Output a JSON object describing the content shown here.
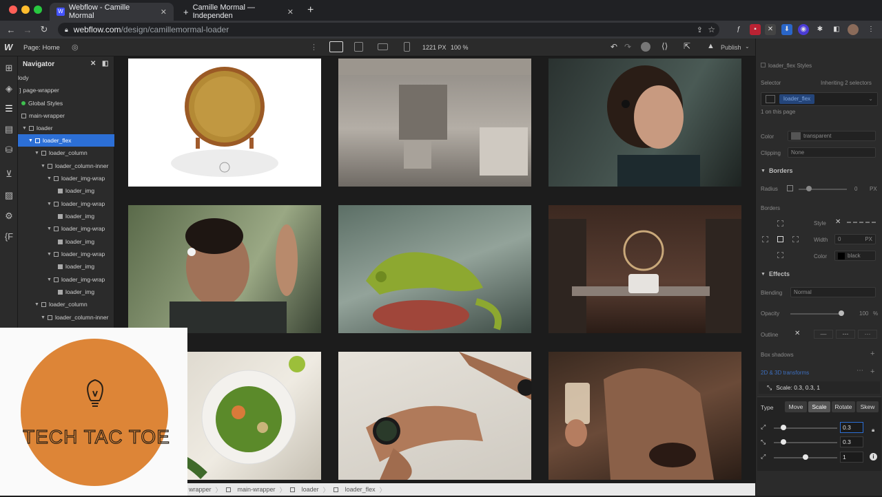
{
  "browser": {
    "tabs": [
      {
        "title": "Webflow - Camille Mormal",
        "active": true
      },
      {
        "title": "Camille Mormal — Independen",
        "active": false
      }
    ],
    "url_host": "webflow.com",
    "url_path": "/design/camillemormal-loader"
  },
  "designer": {
    "page_label": "Page: Home",
    "canvas_width": "1221 PX",
    "zoom": "100 %",
    "publish_label": "Publish"
  },
  "navigator": {
    "title": "Navigator",
    "items": [
      "lody",
      "page-wrapper",
      "Global Styles",
      "main-wrapper",
      "loader",
      "loader_flex",
      "loader_column",
      "loader_column-inner",
      "loader_img-wrap",
      "loader_img",
      "loader_img-wrap",
      "loader_img",
      "loader_img-wrap",
      "loader_img",
      "loader_img-wrap",
      "loader_img",
      "loader_img-wrap",
      "loader_img",
      "loader_column",
      "loader_column-inner"
    ]
  },
  "breadcrumb": [
    "wrapper",
    "main-wrapper",
    "loader",
    "loader_flex"
  ],
  "style_panel": {
    "class_label": "loader_flex Styles",
    "selector_label": "Selector",
    "inheriting": "Inheriting 2 selectors",
    "selector_tag": "loader_flex",
    "on_page": "1 on this page",
    "color_label": "Color",
    "color_value": "transparent",
    "clipping_label": "Clipping",
    "clipping_value": "None",
    "borders_title": "Borders",
    "radius_label": "Radius",
    "radius_value": "0",
    "radius_unit": "PX",
    "borders_label": "Borders",
    "style_label": "Style",
    "width_label": "Width",
    "width_value": "0",
    "width_unit": "PX",
    "bcolor_label": "Color",
    "bcolor_value": "black",
    "effects_title": "Effects",
    "blending_label": "Blending",
    "blending_value": "Normal",
    "opacity_label": "Opacity",
    "opacity_value": "100",
    "opacity_unit": "%",
    "outline_label": "Outline",
    "shadows_label": "Box shadows",
    "transforms_label": "2D & 3D transforms",
    "transform_item": "Scale: 0.3, 0.3, 1"
  },
  "transform_editor": {
    "type_label": "Type",
    "buttons": [
      "Move",
      "Scale",
      "Rotate",
      "Skew"
    ],
    "active": "Scale",
    "x": "0.3",
    "y": "0.3",
    "z": "1",
    "x_level": 0.3,
    "y_level": 0.3,
    "z_level": 1
  },
  "overlay_logo": {
    "text": "TECH TAC TOE",
    "circle_color": "#dd8537"
  },
  "colors": {
    "selection": "#2c6fd6",
    "panel": "#2b2b2b",
    "canvas": "#1c1c1c"
  }
}
